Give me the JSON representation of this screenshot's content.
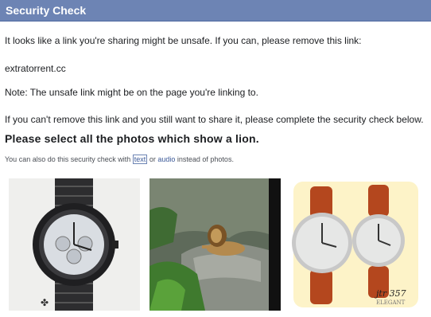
{
  "header": {
    "title": "Security Check"
  },
  "body": {
    "warning_text": "It looks like a link you're sharing might be unsafe. If you can, please remove this link:",
    "link": "extratorrent.cc",
    "note": "Note: The unsafe link might be on the page you're linking to.",
    "instruction": "If you can't remove this link and you still want to share it, please complete the security check below.",
    "prompt": "Please select all the photos which show a lion.",
    "alt_prefix": "You can also do this security check with",
    "alt_text_link": "text",
    "alt_or": "or",
    "alt_audio_link": "audio",
    "alt_suffix": "instead of photos."
  },
  "photos": [
    {
      "subject": "wristwatch"
    },
    {
      "subject": "lion"
    },
    {
      "subject": "pair of wristwatches",
      "caption": "jtr 357",
      "brand": "ELEGANT"
    }
  ],
  "colors": {
    "header_bg": "#6d84b4",
    "link": "#3b5998"
  }
}
